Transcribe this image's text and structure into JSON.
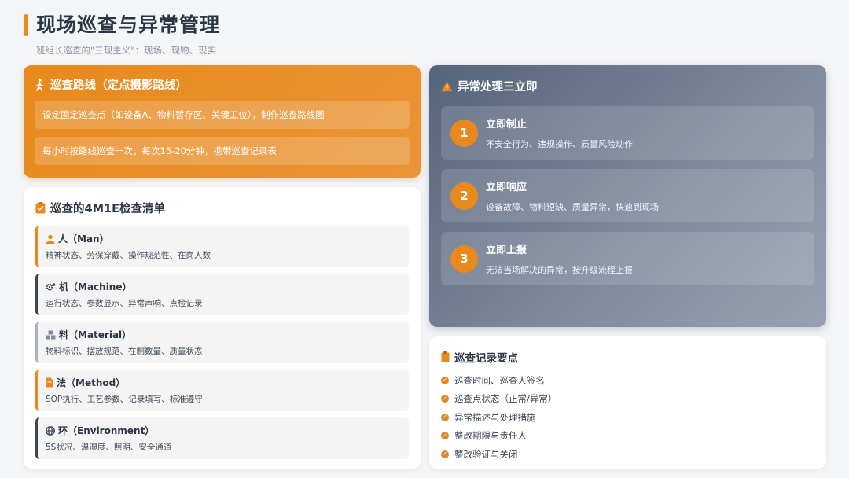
{
  "header": {
    "title": "现场巡查与异常管理",
    "subtitle": "班组长巡查的\"三现主义\"：现场、现物、现实"
  },
  "route": {
    "title": "巡查路线（定点摄影路线）",
    "items": [
      "设定固定巡查点（如设备A、物料暂存区、关键工位），制作巡查路线图",
      "每小时按路线巡查一次，每次15-20分钟，携带巡查记录表"
    ]
  },
  "checklist": {
    "title": "巡查的4M1E检查清单",
    "items": [
      {
        "title": "人（Man）",
        "desc": "精神状态、劳保穿戴、操作规范性、在岗人数"
      },
      {
        "title": "机（Machine）",
        "desc": "运行状态、参数显示、异常声响、点检记录"
      },
      {
        "title": "料（Material）",
        "desc": "物料标识、摆放规范、在制数量、质量状态"
      },
      {
        "title": "法（Method）",
        "desc": "SOP执行、工艺参数、记录填写、标准遵守"
      },
      {
        "title": "环（Environment）",
        "desc": "5S状况、温湿度、照明、安全通道"
      }
    ]
  },
  "anomaly": {
    "title": "异常处理三立即",
    "items": [
      {
        "num": "1",
        "title": "立即制止",
        "desc": "不安全行为、违规操作、质量风险动作"
      },
      {
        "num": "2",
        "title": "立即响应",
        "desc": "设备故障、物料短缺、质量异常，快速到现场"
      },
      {
        "num": "3",
        "title": "立即上报",
        "desc": "无法当场解决的异常，按升级流程上报"
      }
    ]
  },
  "records": {
    "title": "巡查记录要点",
    "items": [
      "巡查时间、巡查人签名",
      "巡查点状态（正常/异常）",
      "异常描述与处理措施",
      "整改期限与责任人",
      "整改验证与关闭"
    ]
  },
  "colors": {
    "accent": "#e8891e",
    "slate": "#56647b",
    "text": "#2b3646"
  }
}
